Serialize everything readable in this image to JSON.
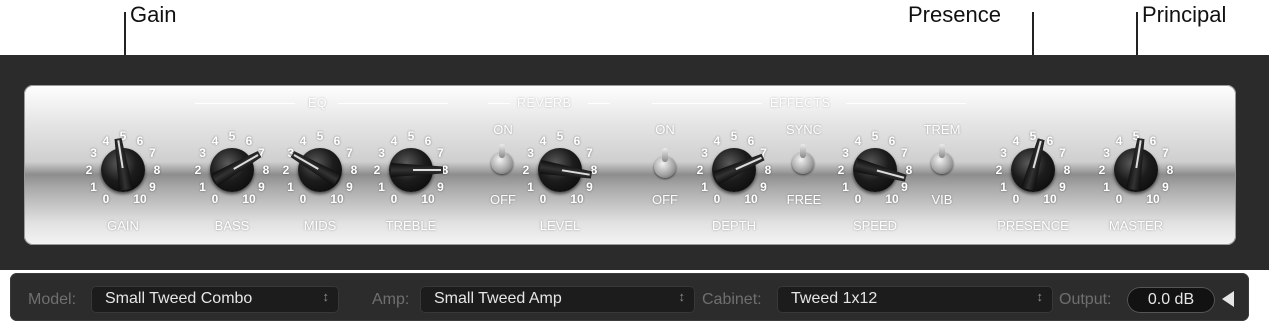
{
  "callouts": {
    "gain": "Gain",
    "presence": "Presence",
    "principal": "Principal"
  },
  "sections": {
    "eq": "EQ",
    "reverb": "REVERB",
    "effects": "EFFECTS"
  },
  "knobs": [
    {
      "name": "gain",
      "label": "GAIN",
      "value": 4.7,
      "ticks": [
        "0",
        "1",
        "2",
        "3",
        "4",
        "5",
        "6",
        "7",
        "8",
        "9",
        "10"
      ]
    },
    {
      "name": "bass",
      "label": "BASS",
      "value": 7.0,
      "ticks": [
        "0",
        "1",
        "2",
        "3",
        "4",
        "5",
        "6",
        "7",
        "8",
        "9",
        "10"
      ]
    },
    {
      "name": "mids",
      "label": "MIDS",
      "value": 3.0,
      "ticks": [
        "0",
        "1",
        "2",
        "3",
        "4",
        "5",
        "6",
        "7",
        "8",
        "9",
        "10"
      ]
    },
    {
      "name": "treble",
      "label": "TREBLE",
      "value": 8.0,
      "ticks": [
        "0",
        "1",
        "2",
        "3",
        "4",
        "5",
        "6",
        "7",
        "8",
        "9",
        "10"
      ]
    },
    {
      "name": "level",
      "label": "LEVEL",
      "value": 8.3,
      "ticks": [
        "0",
        "1",
        "2",
        "3",
        "4",
        "5",
        "6",
        "7",
        "8",
        "9",
        "10"
      ]
    },
    {
      "name": "depth",
      "label": "DEPTH",
      "value": 7.2,
      "ticks": [
        "0",
        "1",
        "2",
        "3",
        "4",
        "5",
        "6",
        "7",
        "8",
        "9",
        "10"
      ]
    },
    {
      "name": "speed",
      "label": "SPEED",
      "value": 8.5,
      "ticks": [
        "0",
        "1",
        "2",
        "3",
        "4",
        "5",
        "6",
        "7",
        "8",
        "9",
        "10"
      ]
    },
    {
      "name": "presence",
      "label": "PRESENCE",
      "value": 5.5,
      "ticks": [
        "0",
        "1",
        "2",
        "3",
        "4",
        "5",
        "6",
        "7",
        "8",
        "9",
        "10"
      ]
    },
    {
      "name": "master",
      "label": "MASTER",
      "value": 5.3,
      "ticks": [
        "0",
        "1",
        "2",
        "3",
        "4",
        "5",
        "6",
        "7",
        "8",
        "9",
        "10"
      ]
    }
  ],
  "switches": {
    "reverb": {
      "top": "ON",
      "bottom": "OFF",
      "state": "ON"
    },
    "effects": {
      "top": "ON",
      "bottom": "OFF",
      "state": "OFF"
    },
    "sync": {
      "top": "SYNC",
      "bottom": "FREE",
      "state": "SYNC"
    },
    "trem": {
      "top": "TREM",
      "bottom": "VIB",
      "state": "TREM"
    }
  },
  "bottom": {
    "model_label": "Model:",
    "model_value": "Small Tweed Combo",
    "amp_label": "Amp:",
    "amp_value": "Small Tweed Amp",
    "cabinet_label": "Cabinet:",
    "cabinet_value": "Tweed 1x12",
    "output_label": "Output:",
    "output_value": "0.0 dB",
    "select_arrow": "↕"
  },
  "colors": {
    "panel_bg": "#2b2b2b",
    "label_gray": "#6f6f6f"
  }
}
